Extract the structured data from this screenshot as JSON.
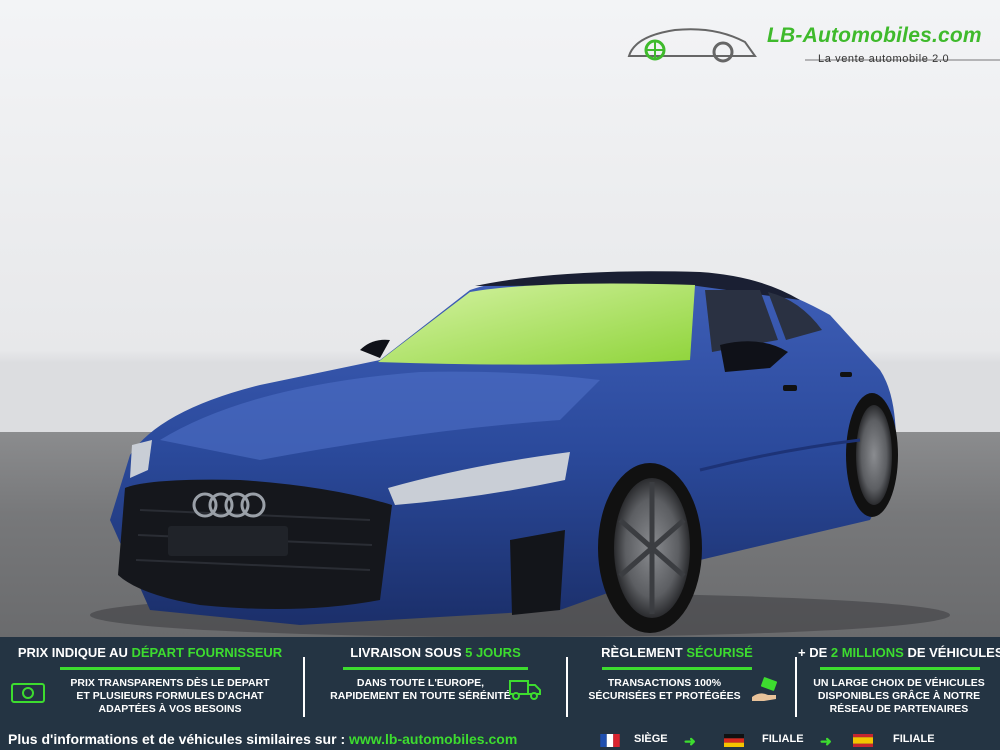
{
  "brand": {
    "name": "LB-Automobiles.com",
    "tagline": "La vente automobile 2.0",
    "accent_color": "#3ddc2f"
  },
  "features": [
    {
      "title_prefix": "PRIX INDIQUE AU ",
      "title_highlight": "DÉPART FOURNISSEUR",
      "title_suffix": "",
      "lines": [
        "PRIX TRANSPARENTS DÈS LE DEPART",
        "ET PLUSIEURS FORMULES D'ACHAT",
        "ADAPTÉES À VOS BESOINS"
      ],
      "icon": "money-icon"
    },
    {
      "title_prefix": "LIVRAISON SOUS ",
      "title_highlight": "5 JOURS",
      "title_suffix": "",
      "lines": [
        "DANS TOUTE L'EUROPE,",
        "RAPIDEMENT EN TOUTE SÉRÉNITÉ"
      ],
      "icon": "truck-icon"
    },
    {
      "title_prefix": "RÈGLEMENT ",
      "title_highlight": "SÉCURISÉ",
      "title_suffix": "",
      "lines": [
        "TRANSACTIONS 100%",
        "SÉCURISÉES ET PROTÉGÉES"
      ],
      "icon": "payment-hand-icon"
    },
    {
      "title_prefix": "+ DE ",
      "title_highlight": "2 MILLIONS",
      "title_suffix": " DE VÉHICULES",
      "lines": [
        "UN LARGE CHOIX DE VÉHICULES",
        "DISPONIBLES GRÂCE À NOTRE",
        "RÉSEAU DE PARTENAIRES"
      ],
      "icon": ""
    }
  ],
  "footer": {
    "text": "Plus d'informations et de véhicules similaires sur : ",
    "url": "www.lb-automobiles.com",
    "locations": [
      {
        "label": "SIÈGE",
        "flag": "flag-france-icon"
      },
      {
        "label": "FILIALE",
        "flag": "flag-germany-icon"
      },
      {
        "label": "FILIALE",
        "flag": "flag-spain-icon"
      }
    ]
  }
}
